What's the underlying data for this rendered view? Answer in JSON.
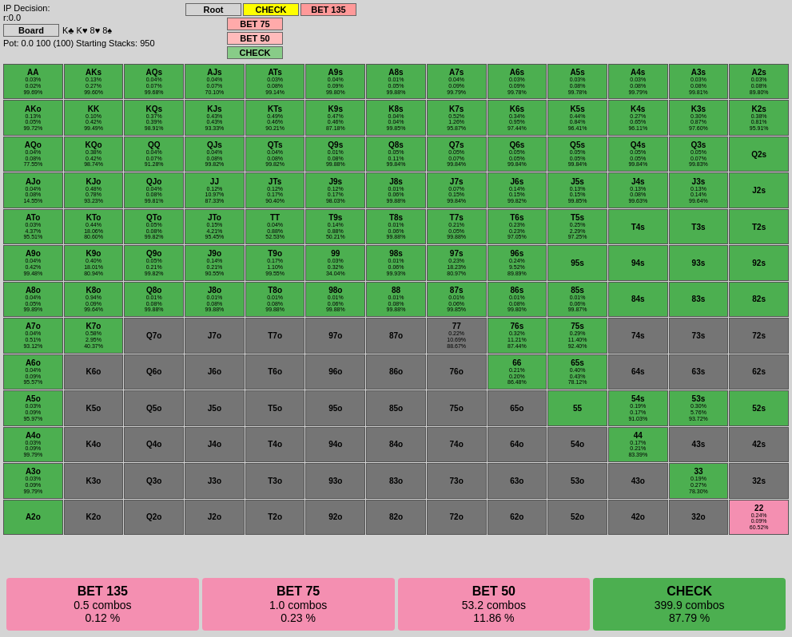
{
  "header": {
    "ip_decision": "IP Decision:",
    "r0": "r:0.0",
    "board": "Board",
    "suits": "K♣ K♥ 8♥ 8♠",
    "pot": "Pot: 0.0 100 (100) Starting Stacks: 950"
  },
  "action_buttons": [
    {
      "label": "Root",
      "class": "btn-root"
    },
    {
      "label": "CHECK",
      "class": "btn-check-active"
    },
    {
      "label": "BET 135",
      "class": "btn-bet135"
    },
    {
      "label": "BET 75",
      "class": "btn-bet75"
    },
    {
      "label": "BET 50",
      "class": "btn-bet50"
    },
    {
      "label": "CHECK",
      "class": "btn-check-right"
    }
  ],
  "summary": [
    {
      "action": "BET 135",
      "combos": "0.5 combos",
      "pct": "0.12 %",
      "class": "bet135"
    },
    {
      "action": "BET 75",
      "combos": "1.0 combos",
      "pct": "0.23 %",
      "class": "bet75"
    },
    {
      "action": "BET 50",
      "combos": "53.2 combos",
      "pct": "11.86 %",
      "class": "bet50"
    },
    {
      "action": "CHECK",
      "combos": "399.9 combos",
      "pct": "87.79 %",
      "class": "check"
    }
  ],
  "colors": {
    "green": "#4CAF50",
    "pink": "#F48FB1",
    "darkgray": "#757575",
    "lightgray": "#BDBDBD",
    "yellow": "#FFFF00"
  }
}
